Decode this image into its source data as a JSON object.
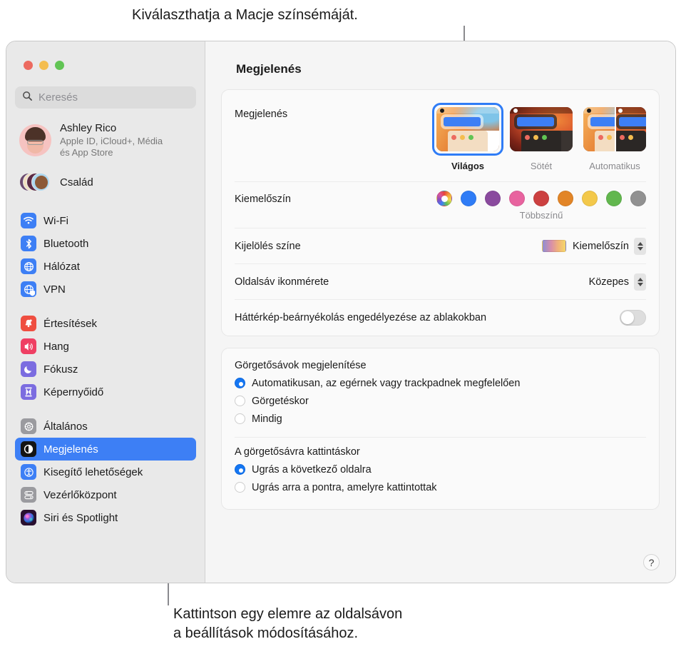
{
  "callouts": {
    "top": "Kiválaszthatja a Macje színsémáját.",
    "bottom": "Kattintson egy elemre az oldalsávon\na beállítások módosításához."
  },
  "window": {
    "title": "Megjelenés",
    "traffic_lights": [
      "close",
      "minimize",
      "zoom"
    ]
  },
  "sidebar": {
    "search": {
      "placeholder": "Keresés",
      "icon": "search-icon"
    },
    "account": {
      "name": "Ashley Rico",
      "subtitle": "Apple ID, iCloud+, Média\nés App Store",
      "avatar": "memoji-avatar"
    },
    "family": {
      "label": "Család",
      "icon": "family-avatars-icon"
    },
    "groups": [
      {
        "items": [
          {
            "label": "Wi-Fi",
            "icon": "wifi-icon",
            "color": "#3d7ff5",
            "selected": false
          },
          {
            "label": "Bluetooth",
            "icon": "bluetooth-icon",
            "color": "#3d7ff5",
            "selected": false
          },
          {
            "label": "Hálózat",
            "icon": "globe-icon",
            "color": "#3d7ff5",
            "selected": false
          },
          {
            "label": "VPN",
            "icon": "globe-shield-icon",
            "color": "#3d7ff5",
            "selected": false
          }
        ]
      },
      {
        "items": [
          {
            "label": "Értesítések",
            "icon": "bell-icon",
            "color": "#ef4e40",
            "selected": false
          },
          {
            "label": "Hang",
            "icon": "speaker-icon",
            "color": "#ef3f63",
            "selected": false
          },
          {
            "label": "Fókusz",
            "icon": "moon-icon",
            "color": "#7b6ce0",
            "selected": false
          },
          {
            "label": "Képernyőidő",
            "icon": "hourglass-icon",
            "color": "#7b6ce0",
            "selected": false
          }
        ]
      },
      {
        "items": [
          {
            "label": "Általános",
            "icon": "gear-icon",
            "color": "#9b9b9f",
            "selected": false
          },
          {
            "label": "Megjelenés",
            "icon": "appearance-icon",
            "color": "#141414",
            "selected": true
          },
          {
            "label": "Kisegítő lehetőségek",
            "icon": "accessibility-icon",
            "color": "#3d7ff5",
            "selected": false
          },
          {
            "label": "Vezérlőközpont",
            "icon": "control-center-icon",
            "color": "#9b9b9f",
            "selected": false
          },
          {
            "label": "Siri és Spotlight",
            "icon": "siri-icon",
            "color": "#5a2f7a",
            "selected": false
          }
        ]
      }
    ]
  },
  "main": {
    "appearance": {
      "label": "Megjelenés",
      "options": [
        {
          "label": "Világos",
          "value": "light",
          "selected": true
        },
        {
          "label": "Sötét",
          "value": "dark",
          "selected": false
        },
        {
          "label": "Automatikus",
          "value": "auto",
          "selected": false
        }
      ]
    },
    "accent": {
      "label": "Kiemelőszín",
      "caption": "Többszínű",
      "selected_index": 0,
      "colors": [
        {
          "name": "multicolor",
          "hex": "multi"
        },
        {
          "name": "blue",
          "hex": "#2f7cf6"
        },
        {
          "name": "purple",
          "hex": "#8a4a9e"
        },
        {
          "name": "pink",
          "hex": "#e8639f"
        },
        {
          "name": "red",
          "hex": "#cc4040"
        },
        {
          "name": "orange",
          "hex": "#e28527"
        },
        {
          "name": "yellow",
          "hex": "#f3c84a"
        },
        {
          "name": "green",
          "hex": "#62b74e"
        },
        {
          "name": "graphite",
          "hex": "#919191"
        }
      ]
    },
    "highlight": {
      "label": "Kijelölés színe",
      "value": "Kiemelőszín",
      "swatch": "gradient-chip"
    },
    "sidebar_icon_size": {
      "label": "Oldalsáv ikonmérete",
      "value": "Közepes"
    },
    "wallpaper_tinting": {
      "label": "Háttérkép-beárnyékolás engedélyezése az ablakokban",
      "enabled": false
    },
    "scrollbars": {
      "title": "Görgetősávok megjelenítése",
      "options": [
        {
          "label": "Automatikusan, az egérnek vagy trackpadnek megfelelően",
          "selected": true
        },
        {
          "label": "Görgetéskor",
          "selected": false
        },
        {
          "label": "Mindig",
          "selected": false
        }
      ]
    },
    "scrollbar_click": {
      "title": "A görgetősávra kattintáskor",
      "options": [
        {
          "label": "Ugrás a következő oldalra",
          "selected": true
        },
        {
          "label": "Ugrás arra a pontra, amelyre kattintottak",
          "selected": false
        }
      ]
    },
    "help_button": {
      "label": "?",
      "icon": "help-icon"
    }
  }
}
